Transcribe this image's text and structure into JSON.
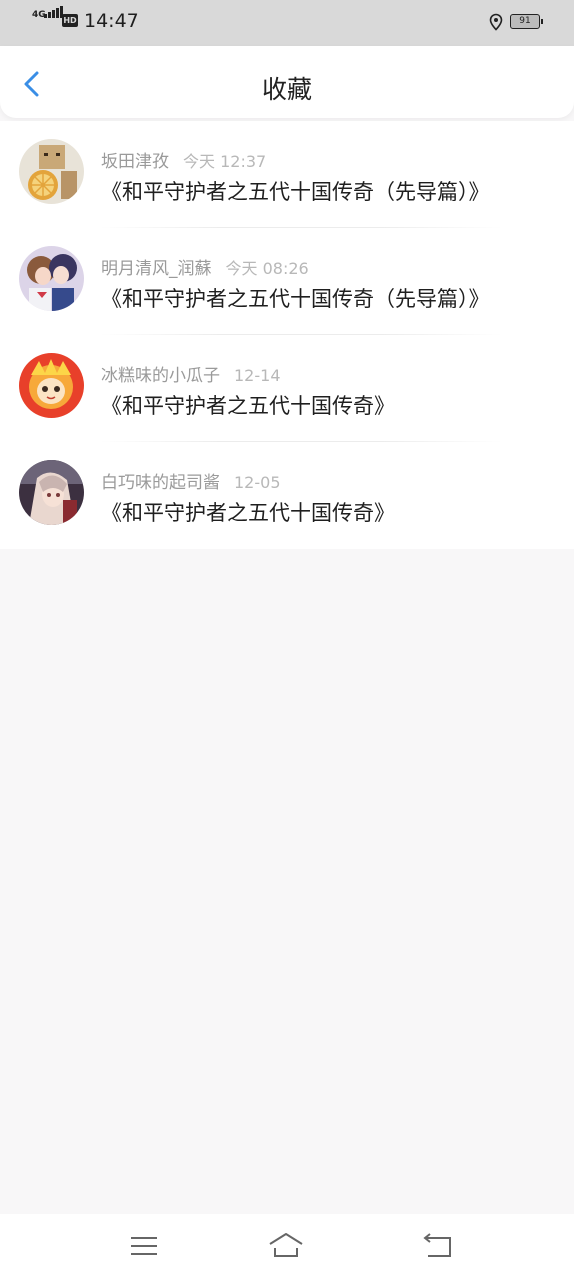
{
  "status_bar": {
    "network": "4G",
    "hd": "HD",
    "time": "14:47",
    "battery": "91"
  },
  "header": {
    "title": "收藏"
  },
  "favorites": [
    {
      "user": "坂田津孜",
      "time": "今天 12:37",
      "title": "《和平守护者之五代十国传奇（先导篇）》"
    },
    {
      "user": "明月清风_润蘇",
      "time": "今天 08:26",
      "title": "《和平守护者之五代十国传奇（先导篇）》"
    },
    {
      "user": "冰糕味的小瓜子",
      "time": "12-14",
      "title": "《和平守护者之五代十国传奇》"
    },
    {
      "user": "白巧味的起司酱",
      "time": "12-05",
      "title": "《和平守护者之五代十国传奇》"
    }
  ],
  "colors": {
    "accent": "#3a8ee6",
    "background": "#f8f7f8"
  }
}
